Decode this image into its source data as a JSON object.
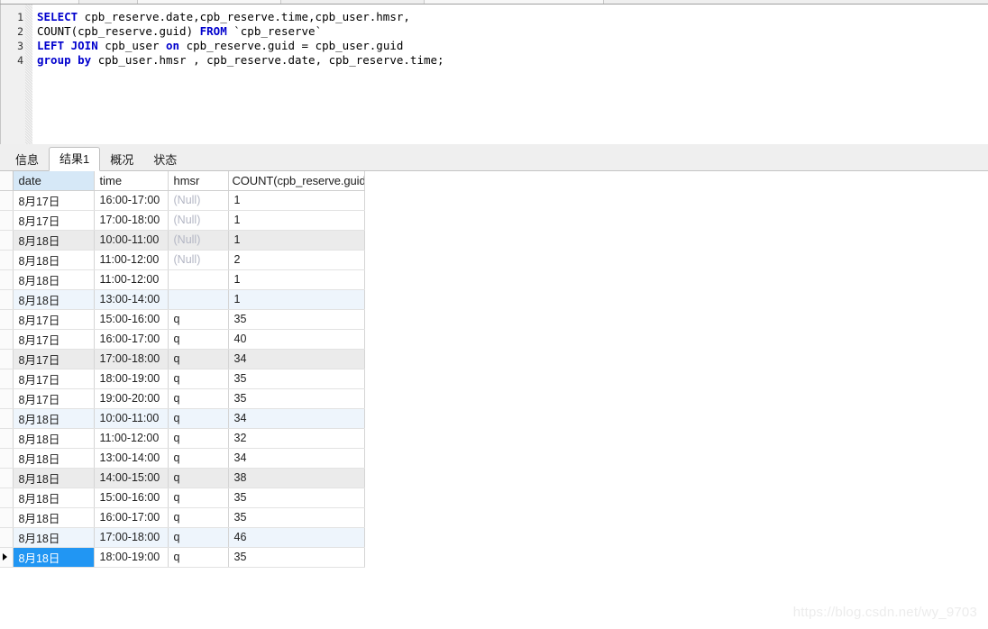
{
  "window": {
    "top_chrome_visible": true
  },
  "editor": {
    "line_numbers": [
      "1",
      "2",
      "3",
      "4"
    ],
    "lines": [
      [
        {
          "t": "SELECT",
          "k": true
        },
        {
          "t": " cpb_reserve.date,cpb_reserve.time,cpb_user.hmsr,",
          "k": false
        }
      ],
      [
        {
          "t": "COUNT(cpb_reserve.guid) ",
          "k": false
        },
        {
          "t": "FROM",
          "k": true
        },
        {
          "t": " `cpb_reserve`",
          "k": false
        }
      ],
      [
        {
          "t": "LEFT JOIN",
          "k": true
        },
        {
          "t": " cpb_user ",
          "k": false
        },
        {
          "t": "on",
          "k": true
        },
        {
          "t": " cpb_reserve.guid = cpb_user.guid",
          "k": false
        }
      ],
      [
        {
          "t": "group by",
          "k": true
        },
        {
          "t": " cpb_user.hmsr , cpb_reserve.date, cpb_reserve.time;",
          "k": false
        }
      ]
    ]
  },
  "tabs": [
    {
      "label": "信息",
      "active": false
    },
    {
      "label": "结果1",
      "active": true
    },
    {
      "label": "概况",
      "active": false
    },
    {
      "label": "状态",
      "active": false
    }
  ],
  "grid": {
    "columns": [
      {
        "key": "date",
        "label": "date",
        "align": "left",
        "sorted": true
      },
      {
        "key": "time",
        "label": "time",
        "align": "left",
        "sorted": false
      },
      {
        "key": "hmsr",
        "label": "hmsr",
        "align": "left",
        "sorted": false
      },
      {
        "key": "count",
        "label": "COUNT(cpb_reserve.guid",
        "align": "right",
        "sorted": false
      }
    ],
    "selected_row_index": 18,
    "rows": [
      {
        "date": "8月17日",
        "time": "16:00-17:00",
        "hmsr": "(Null)",
        "hmsr_null": true,
        "count": "1"
      },
      {
        "date": "8月17日",
        "time": "17:00-18:00",
        "hmsr": "(Null)",
        "hmsr_null": true,
        "count": "1"
      },
      {
        "date": "8月18日",
        "time": "10:00-11:00",
        "hmsr": "(Null)",
        "hmsr_null": true,
        "count": "1"
      },
      {
        "date": "8月18日",
        "time": "11:00-12:00",
        "hmsr": "(Null)",
        "hmsr_null": true,
        "count": "2"
      },
      {
        "date": "8月18日",
        "time": "11:00-12:00",
        "hmsr": "",
        "hmsr_null": false,
        "count": "1"
      },
      {
        "date": "8月18日",
        "time": "13:00-14:00",
        "hmsr": "",
        "hmsr_null": false,
        "count": "1"
      },
      {
        "date": "8月17日",
        "time": "15:00-16:00",
        "hmsr": "q",
        "hmsr_null": false,
        "count": "35"
      },
      {
        "date": "8月17日",
        "time": "16:00-17:00",
        "hmsr": "q",
        "hmsr_null": false,
        "count": "40"
      },
      {
        "date": "8月17日",
        "time": "17:00-18:00",
        "hmsr": "q",
        "hmsr_null": false,
        "count": "34"
      },
      {
        "date": "8月17日",
        "time": "18:00-19:00",
        "hmsr": "q",
        "hmsr_null": false,
        "count": "35"
      },
      {
        "date": "8月17日",
        "time": "19:00-20:00",
        "hmsr": "q",
        "hmsr_null": false,
        "count": "35"
      },
      {
        "date": "8月18日",
        "time": "10:00-11:00",
        "hmsr": "q",
        "hmsr_null": false,
        "count": "34"
      },
      {
        "date": "8月18日",
        "time": "11:00-12:00",
        "hmsr": "q",
        "hmsr_null": false,
        "count": "32"
      },
      {
        "date": "8月18日",
        "time": "13:00-14:00",
        "hmsr": "q",
        "hmsr_null": false,
        "count": "34"
      },
      {
        "date": "8月18日",
        "time": "14:00-15:00",
        "hmsr": "q",
        "hmsr_null": false,
        "count": "38"
      },
      {
        "date": "8月18日",
        "time": "15:00-16:00",
        "hmsr": "q",
        "hmsr_null": false,
        "count": "35"
      },
      {
        "date": "8月18日",
        "time": "16:00-17:00",
        "hmsr": "q",
        "hmsr_null": false,
        "count": "35"
      },
      {
        "date": "8月18日",
        "time": "17:00-18:00",
        "hmsr": "q",
        "hmsr_null": false,
        "count": "46"
      },
      {
        "date": "8月18日",
        "time": "18:00-19:00",
        "hmsr": "q",
        "hmsr_null": false,
        "count": "35"
      }
    ]
  },
  "watermark": {
    "text": "https://blog.csdn.net/wy_9703"
  },
  "colors": {
    "keyword": "#0000cd",
    "selection": "#2196f3",
    "stripe_gray": "#ebebeb",
    "stripe_blue": "#eef5fc",
    "sorted_header": "#d6e8f7",
    "null_text": "#b3b6c4",
    "tabbar": "#efefef",
    "watermark": "#ececec"
  }
}
